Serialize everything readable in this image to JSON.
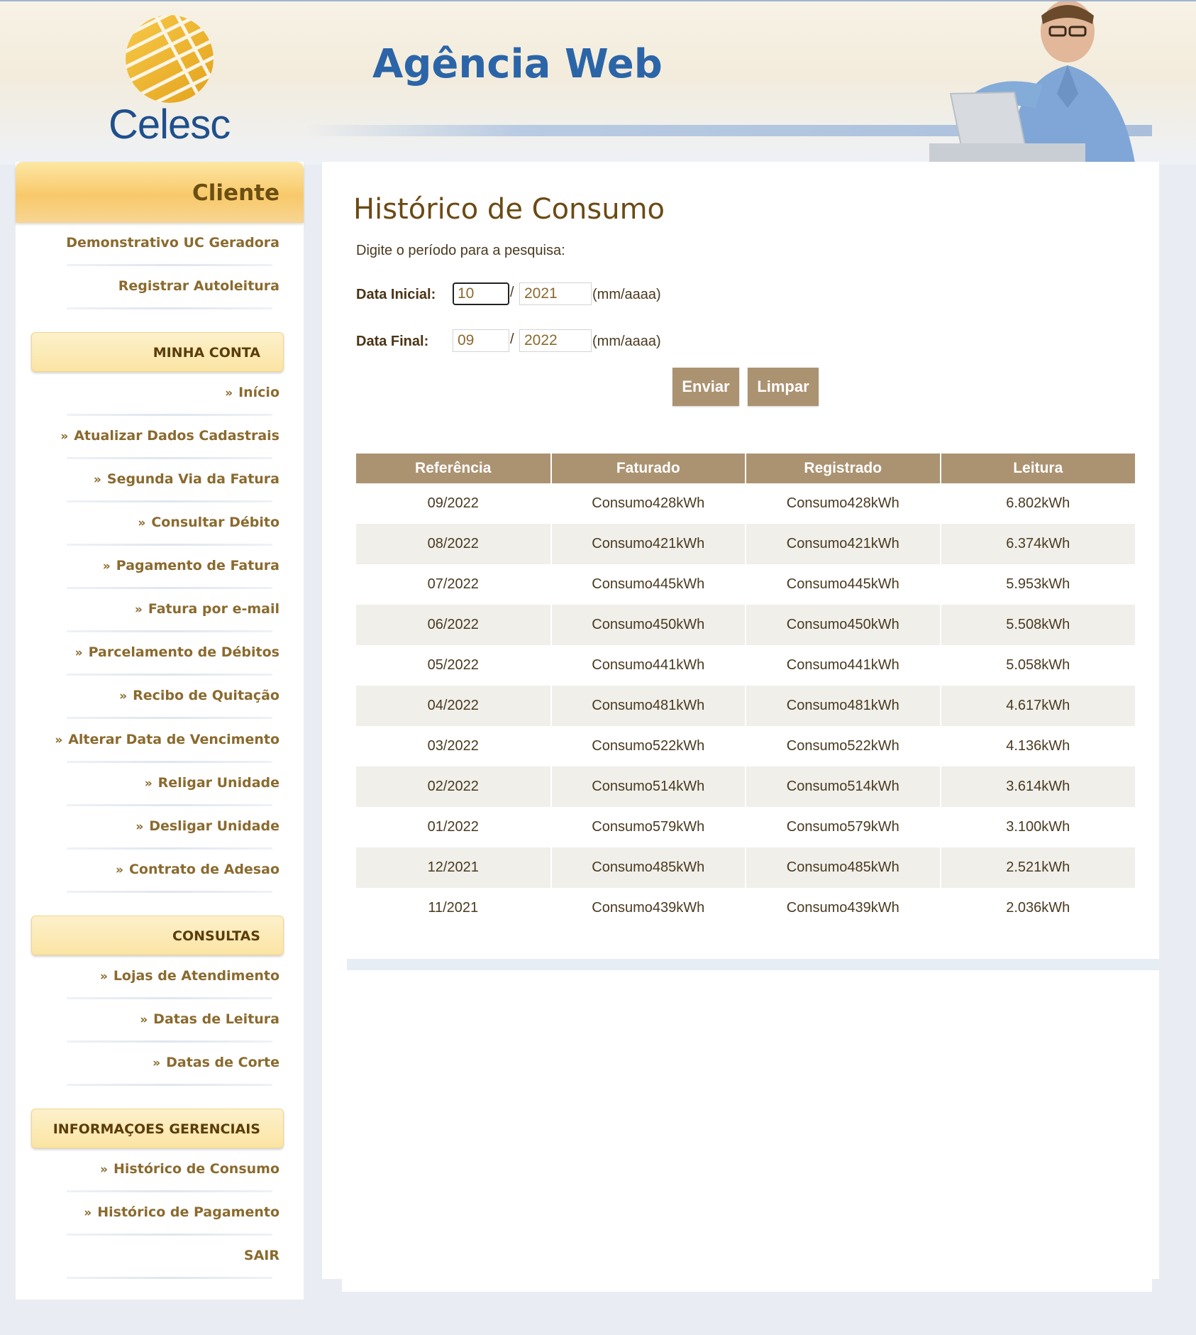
{
  "brand": {
    "logo_text": "Celesc",
    "app_title": "Agência Web"
  },
  "sidebar": {
    "client_title": "Cliente",
    "top_items": [
      {
        "label": "Demonstrativo UC Geradora"
      },
      {
        "label": "Registrar Autoleitura"
      }
    ],
    "minha_conta": {
      "title": "MINHA CONTA",
      "items": [
        {
          "label": "Início"
        },
        {
          "label": "Atualizar Dados Cadastrais"
        },
        {
          "label": "Segunda Via da Fatura"
        },
        {
          "label": "Consultar Débito"
        },
        {
          "label": "Pagamento de Fatura"
        },
        {
          "label": "Fatura por e-mail"
        },
        {
          "label": "Parcelamento de Débitos"
        },
        {
          "label": "Recibo de Quitação"
        },
        {
          "label": "Alterar Data de Vencimento"
        },
        {
          "label": "Religar Unidade"
        },
        {
          "label": "Desligar Unidade"
        },
        {
          "label": "Contrato de Adesao"
        }
      ]
    },
    "consultas": {
      "title": "CONSULTAS",
      "items": [
        {
          "label": "Lojas de Atendimento"
        },
        {
          "label": "Datas de Leitura"
        },
        {
          "label": "Datas de Corte"
        }
      ]
    },
    "gerenciais": {
      "title": "INFORMAÇOES GERENCIAIS",
      "items": [
        {
          "label": "Histórico de Consumo"
        },
        {
          "label": "Histórico de Pagamento"
        }
      ]
    },
    "logout": "SAIR",
    "bullet": "»"
  },
  "main": {
    "title": "Histórico de Consumo",
    "prompt": "Digite o período para a pesquisa:",
    "start": {
      "label": "Data Inicial:",
      "month": "10",
      "year": "2021"
    },
    "end": {
      "label": "Data Final:",
      "month": "09",
      "year": "2022"
    },
    "separator": "/",
    "format_hint": "(mm/aaaa)",
    "submit_label": "Enviar",
    "clear_label": "Limpar",
    "table": {
      "headers": [
        "Referência",
        "Faturado",
        "Registrado",
        "Leitura"
      ],
      "rows": [
        [
          "09/2022",
          "Consumo428kWh",
          "Consumo428kWh",
          "6.802kWh"
        ],
        [
          "08/2022",
          "Consumo421kWh",
          "Consumo421kWh",
          "6.374kWh"
        ],
        [
          "07/2022",
          "Consumo445kWh",
          "Consumo445kWh",
          "5.953kWh"
        ],
        [
          "06/2022",
          "Consumo450kWh",
          "Consumo450kWh",
          "5.508kWh"
        ],
        [
          "05/2022",
          "Consumo441kWh",
          "Consumo441kWh",
          "5.058kWh"
        ],
        [
          "04/2022",
          "Consumo481kWh",
          "Consumo481kWh",
          "4.617kWh"
        ],
        [
          "03/2022",
          "Consumo522kWh",
          "Consumo522kWh",
          "4.136kWh"
        ],
        [
          "02/2022",
          "Consumo514kWh",
          "Consumo514kWh",
          "3.614kWh"
        ],
        [
          "01/2022",
          "Consumo579kWh",
          "Consumo579kWh",
          "3.100kWh"
        ],
        [
          "12/2021",
          "Consumo485kWh",
          "Consumo485kWh",
          "2.521kWh"
        ],
        [
          "11/2021",
          "Consumo439kWh",
          "Consumo439kWh",
          "2.036kWh"
        ]
      ]
    }
  },
  "colors": {
    "accent_brown": "#ab9372",
    "title_brown": "#6b4a14",
    "menu_text": "#8a6a2e",
    "brand_blue": "#2b65a8",
    "logo_gold": "#f2b530"
  }
}
